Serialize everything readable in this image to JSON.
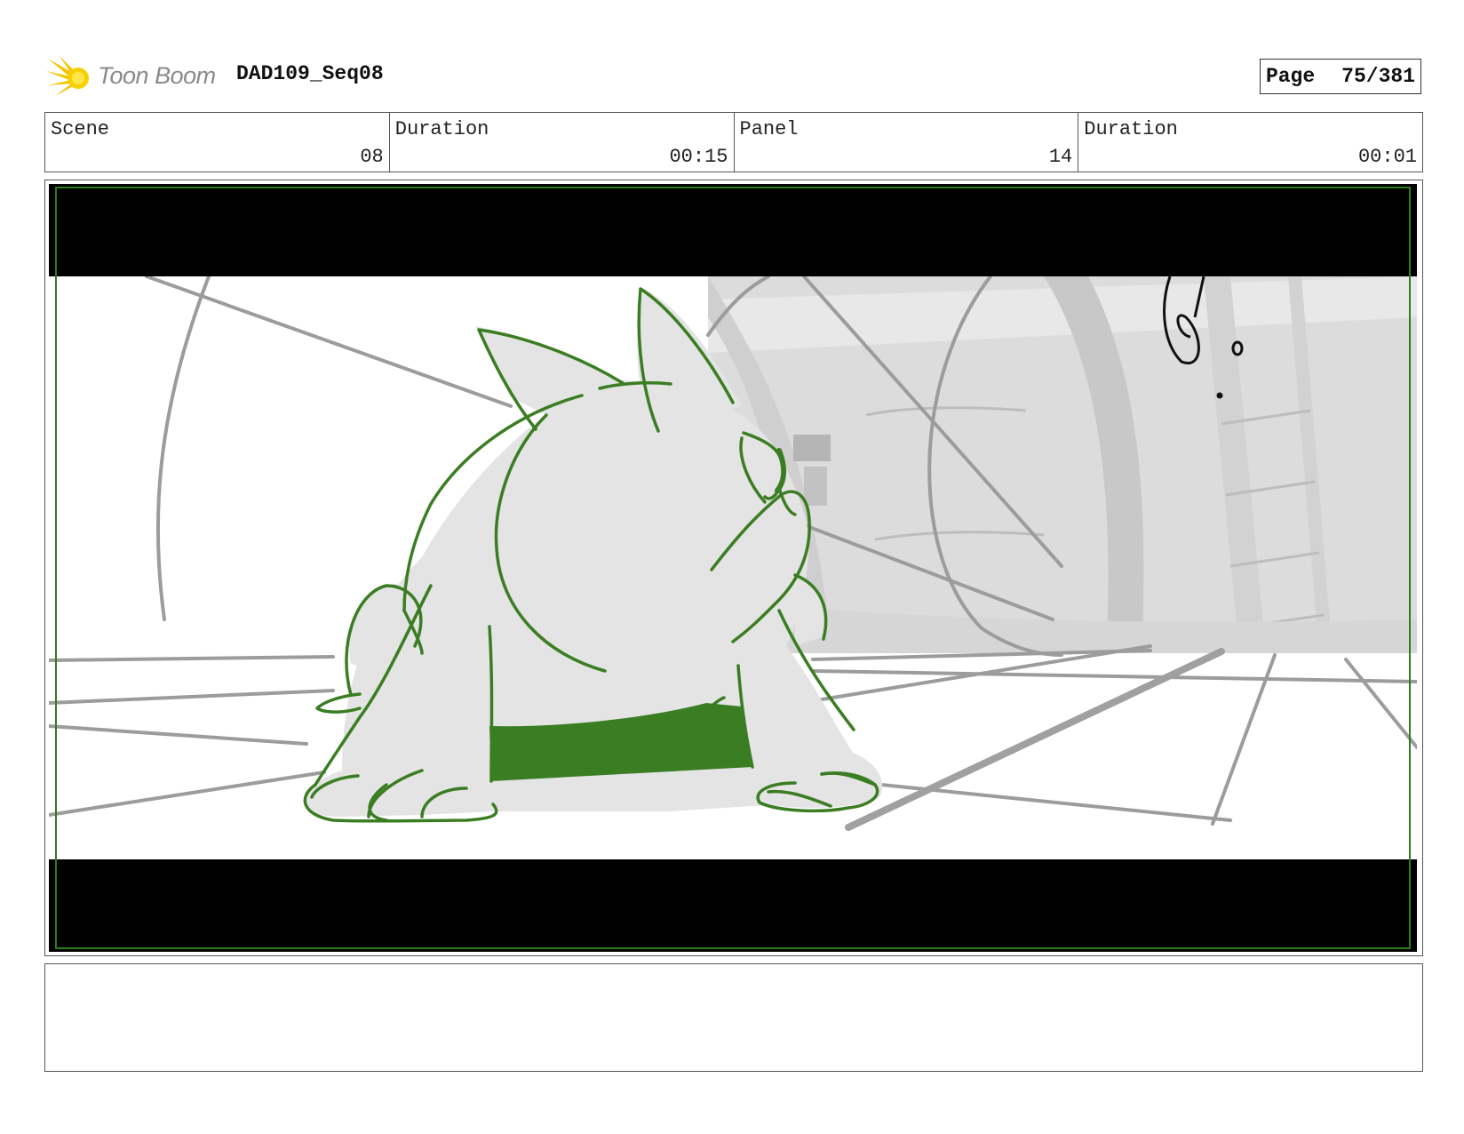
{
  "header": {
    "logo_text": "Toon Boom",
    "project_title": "DAD109_Seq08",
    "page_label": "Page",
    "page_number": "75/381"
  },
  "info": {
    "scene_label": "Scene",
    "scene_value": "08",
    "scene_duration_label": "Duration",
    "scene_duration_value": "00:15",
    "panel_label": "Panel",
    "panel_value": "14",
    "panel_duration_label": "Duration",
    "panel_duration_value": "00:01"
  },
  "panel": {
    "safe_area_color": "#2e7d1e",
    "character_color": "#3a7d22",
    "letterbox_color": "#000000"
  },
  "notes": {
    "text": ""
  }
}
